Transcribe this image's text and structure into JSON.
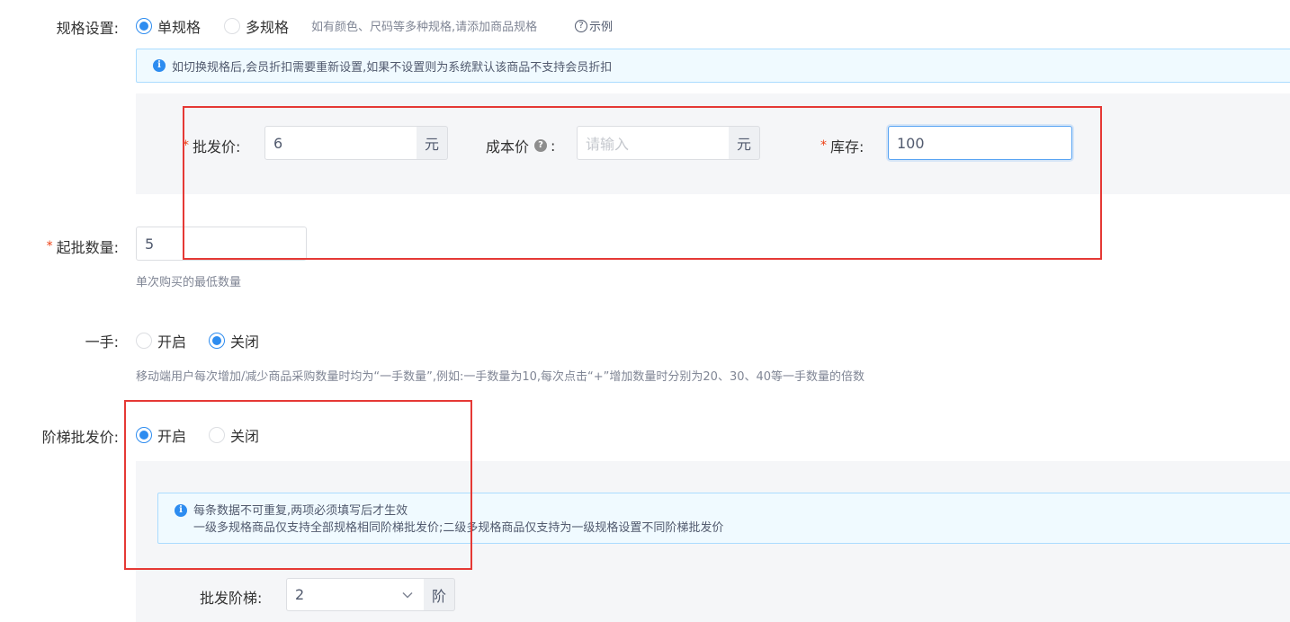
{
  "spec": {
    "label": "规格设置:",
    "options": [
      "单规格",
      "多规格"
    ],
    "selected": "单规格",
    "hint": "如有颜色、尺码等多种规格,请添加商品规格",
    "example_link": "示例",
    "alert": "如切换规格后,会员折扣需要重新设置,如果不设置则为系统默认该商品不支持会员折扣"
  },
  "price_row": {
    "wholesale_label": "批发价:",
    "wholesale_value": "6",
    "wholesale_unit": "元",
    "cost_label": "成本价",
    "cost_colon": ":",
    "cost_placeholder": "请输入",
    "cost_unit": "元",
    "stock_label": "库存:",
    "stock_value": "100"
  },
  "min_qty": {
    "label": "起批数量:",
    "value": "5",
    "hint": "单次购买的最低数量"
  },
  "one_hand": {
    "label": "一手:",
    "options": [
      "开启",
      "关闭"
    ],
    "selected": "关闭",
    "hint": "移动端用户每次增加/减少商品采购数量时均为“一手数量”,例如:一手数量为10,每次点击“+”增加数量时分别为20、30、40等一手数量的倍数"
  },
  "tier_price": {
    "label": "阶梯批发价:",
    "options": [
      "开启",
      "关闭"
    ],
    "selected": "开启",
    "alert_line1": "每条数据不可重复,两项必须填写后才生效",
    "alert_line2": "一级多规格商品仅支持全部规格相同阶梯批发价;二级多规格商品仅支持为一级规格设置不同阶梯批发价",
    "tiers_label": "批发阶梯:",
    "tiers_value": "2",
    "tiers_unit": "阶"
  },
  "colors": {
    "primary": "#2d8cf0",
    "required": "#ed4014",
    "annotation_red": "#e53935",
    "panel_bg": "#f5f6f8",
    "alert_bg": "#f0faff"
  }
}
